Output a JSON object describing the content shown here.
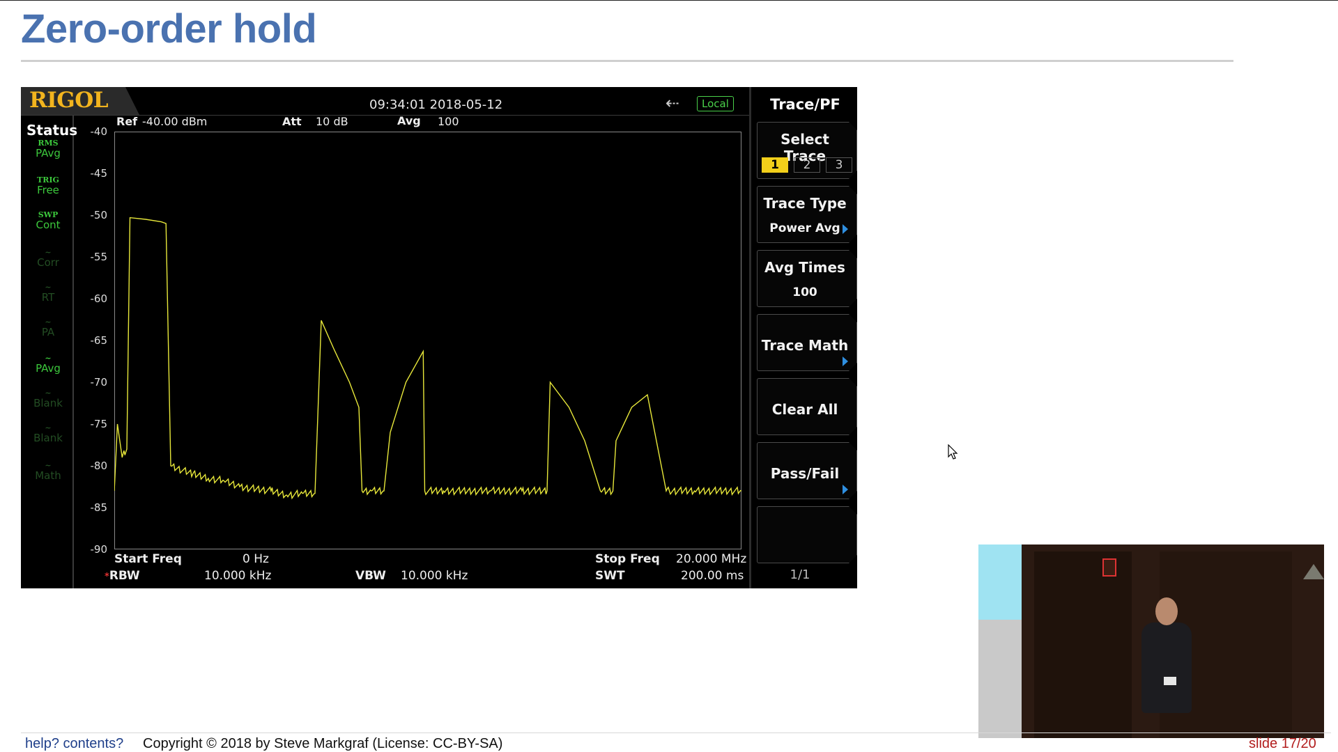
{
  "slide": {
    "title": "Zero-order hold",
    "footer_help": "help?",
    "footer_contents": "contents?",
    "copyright": "Copyright © 2018 by Steve Markgraf (License: CC-BY-SA)",
    "slide_number": "slide 17/20"
  },
  "analyzer": {
    "brand": "RIGOL",
    "datetime": "09:34:01 2018-05-12",
    "remote_badge": "Local",
    "status_header": "Status",
    "status_items": [
      {
        "icon": "RMS",
        "label": "PAvg",
        "active": true
      },
      {
        "icon": "TRIG",
        "label": "Free",
        "active": true
      },
      {
        "icon": "SWP",
        "label": "Cont",
        "active": true
      },
      {
        "icon": "~",
        "label": "Corr",
        "active": false
      },
      {
        "icon": "~",
        "label": "RT",
        "active": false
      },
      {
        "icon": "~",
        "label": "PA",
        "active": false
      },
      {
        "icon": "~",
        "label": "PAvg",
        "active": true
      },
      {
        "icon": "~",
        "label": "Blank",
        "active": false
      },
      {
        "icon": "~",
        "label": "Blank",
        "active": false
      },
      {
        "icon": "~",
        "label": "Math",
        "active": false
      }
    ],
    "header": {
      "ref_label": "Ref",
      "ref_value": "-40.00 dBm",
      "att_label": "Att",
      "att_value": "10 dB",
      "avg_label": "Avg",
      "avg_value": "100"
    },
    "footer": {
      "start_freq_label": "Start Freq",
      "start_freq_value": "0 Hz",
      "stop_freq_label": "Stop Freq",
      "stop_freq_value": "20.000 MHz",
      "rbw_label": "RBW",
      "rbw_value": "10.000 kHz",
      "vbw_label": "VBW",
      "vbw_value": "10.000 kHz",
      "swt_label": "SWT",
      "swt_value": "200.00 ms"
    },
    "menu": {
      "title": "Trace/PF",
      "select_trace": "Select Trace",
      "traces": [
        "1",
        "2",
        "3"
      ],
      "selected_trace": "1",
      "trace_type": "Trace Type",
      "trace_type_value": "Power Avg",
      "avg_times": "Avg Times",
      "avg_times_value": "100",
      "trace_math": "Trace Math",
      "clear_all": "Clear All",
      "pass_fail": "Pass/Fail",
      "page": "1/1"
    },
    "colors": {
      "trace": "#e8e83a",
      "grid": "#8a8a8a",
      "status_green": "#3cc83c",
      "brand": "#f2b41e"
    }
  },
  "chart_data": {
    "type": "line",
    "title": "",
    "xlabel": "",
    "ylabel": "",
    "x_unit": "MHz",
    "y_unit": "dBm",
    "xlim": [
      0,
      20
    ],
    "ylim": [
      -90,
      -40
    ],
    "y_ticks": [
      -40,
      -45,
      -50,
      -55,
      -60,
      -65,
      -70,
      -75,
      -80,
      -85,
      -90
    ],
    "series": [
      {
        "x": [
          0.0,
          0.1,
          0.25,
          0.4,
          0.5,
          1.0,
          1.5,
          1.65,
          1.8,
          2.5,
          3.0,
          3.5,
          4.0,
          5.0,
          5.5,
          6.0,
          6.4,
          6.6,
          7.0,
          7.5,
          7.8,
          7.9,
          8.2,
          8.6,
          8.8,
          9.3,
          9.85,
          9.9,
          10.5,
          12.0,
          13.0,
          13.8,
          13.9,
          14.5,
          15.0,
          15.5,
          15.9,
          16.0,
          16.5,
          17.0,
          17.6,
          17.7,
          18.5,
          20.0
        ],
        "y": [
          -83,
          -75,
          -79,
          -78,
          -50.3,
          -50.5,
          -50.8,
          -51,
          -80,
          -81,
          -81.5,
          -81.8,
          -82.5,
          -83,
          -83.5,
          -83.3,
          -83.3,
          -62.6,
          -66,
          -70,
          -73,
          -83,
          -83,
          -83,
          -76,
          -70,
          -66.3,
          -83,
          -83,
          -83,
          -83,
          -83,
          -70,
          -73,
          -77,
          -83,
          -83,
          -77,
          -73,
          -71.5,
          -83,
          -83,
          -83,
          -83
        ]
      }
    ]
  }
}
